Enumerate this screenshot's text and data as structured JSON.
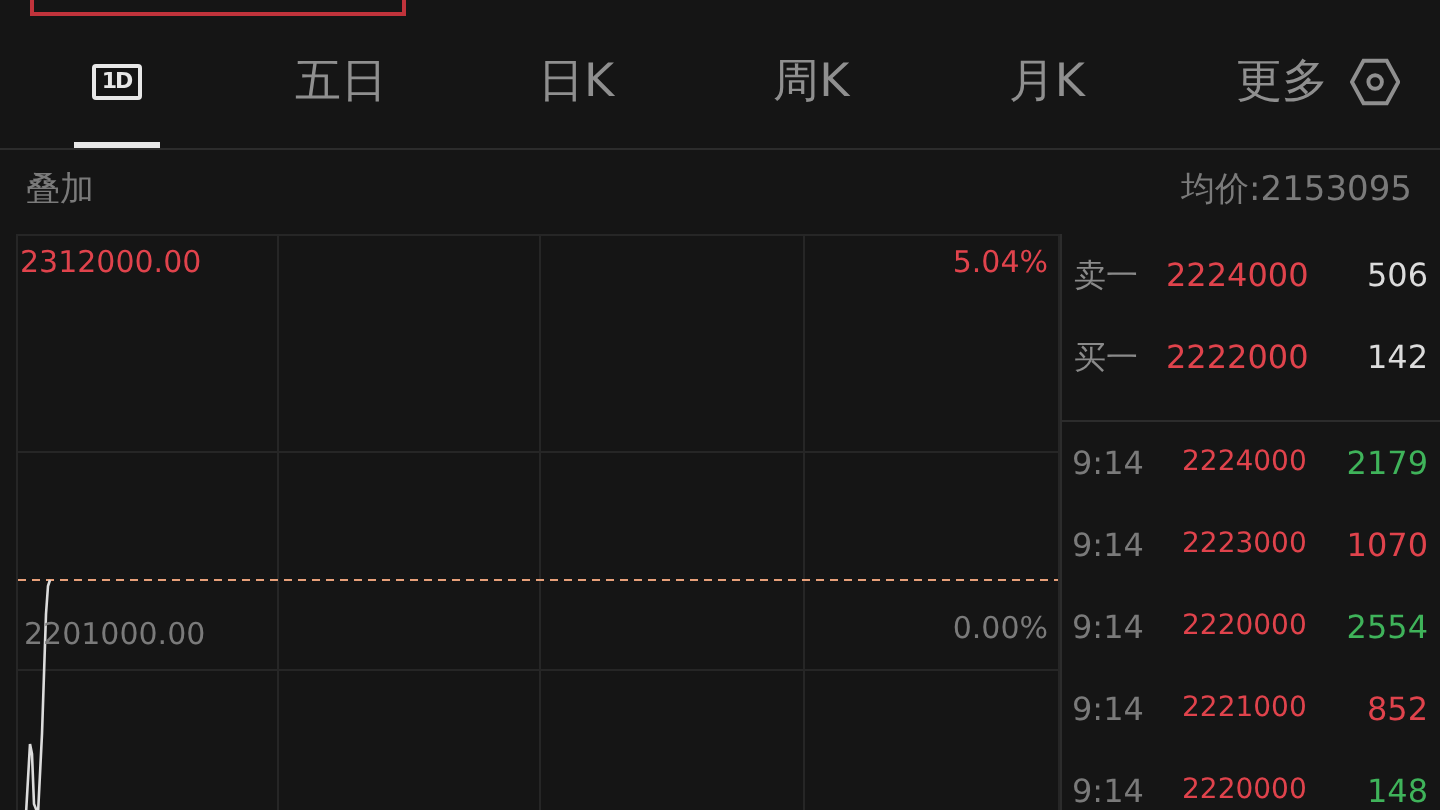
{
  "tabs": [
    {
      "label": "1D",
      "kind": "icon",
      "selected": true
    },
    {
      "label": "五日",
      "kind": "text",
      "selected": false
    },
    {
      "label": "日K",
      "kind": "text",
      "selected": false
    },
    {
      "label": "周K",
      "kind": "text",
      "selected": false
    },
    {
      "label": "月K",
      "kind": "text",
      "selected": false
    },
    {
      "label": "更多",
      "kind": "text",
      "selected": false
    }
  ],
  "overlay_label": "叠加",
  "avg_price": "均价:2153095",
  "chart": {
    "top_price": "2312000.00",
    "top_percent": "5.04%",
    "base_price": "2201000.00",
    "base_percent": "0.00%"
  },
  "quotes": [
    {
      "label": "卖一",
      "price": "2224000",
      "volume": "506"
    },
    {
      "label": "买一",
      "price": "2222000",
      "volume": "142"
    }
  ],
  "trades": [
    {
      "time": "9:14",
      "price": "2224000",
      "volume": "2179",
      "color": "#3fb35a"
    },
    {
      "time": "9:14",
      "price": "2223000",
      "volume": "1070",
      "color": "#e0434c"
    },
    {
      "time": "9:14",
      "price": "2220000",
      "volume": "2554",
      "color": "#3fb35a"
    },
    {
      "time": "9:14",
      "price": "2221000",
      "volume": "852",
      "color": "#e0434c"
    },
    {
      "time": "9:14",
      "price": "2220000",
      "volume": "148",
      "color": "#3fb35a"
    }
  ]
}
